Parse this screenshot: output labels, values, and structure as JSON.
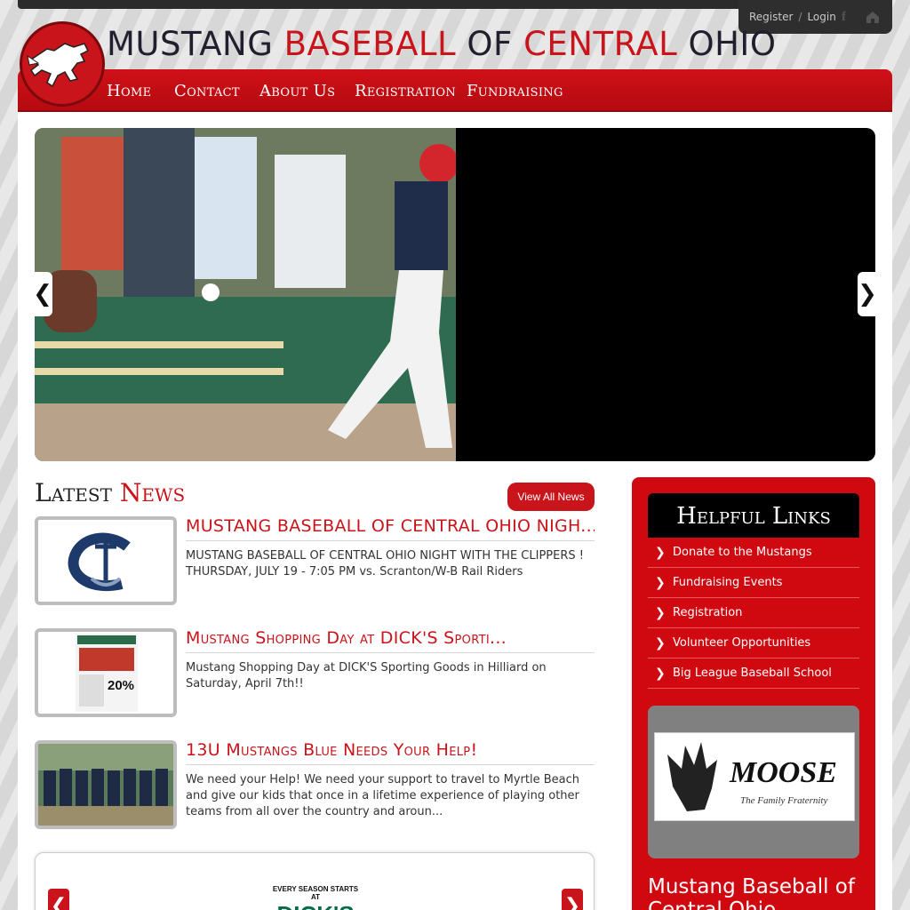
{
  "header": {
    "title_part1": "MUSTANG ",
    "title_part2": "BASEBALL",
    "title_part3": " OF ",
    "title_part4": "CENTRAL",
    "title_part5": " OHIO",
    "register_label": "Register",
    "separator": "/",
    "login_label": "Login",
    "facebook_glyph": "f"
  },
  "nav": {
    "items": [
      {
        "label": "Home"
      },
      {
        "label": "Contact"
      },
      {
        "label": "About Us"
      },
      {
        "label": "Registration"
      },
      {
        "label": "Fundraising"
      }
    ]
  },
  "slider": {
    "prev_glyph": "❮",
    "next_glyph": "❯",
    "dot_count": 3,
    "active_dot": 2
  },
  "news": {
    "heading_part1": "Latest ",
    "heading_part2": "News",
    "view_all_label": "View All News",
    "items": [
      {
        "title": "MUSTANG BASEBALL OF CENTRAL OHIO NIGH...",
        "description": "MUSTANG BASEBALL OF CENTRAL OHIO NIGHT WITH THE CLIPPERS ! THURSDAY, JULY 19 - 7:05 PM vs. Scranton/W-B Rail Riders"
      },
      {
        "title": "Mustang Shopping Day at DICK'S Sporti...",
        "description": "Mustang Shopping Day at DICK'S Sporting Goods in Hilliard on Saturday, April 7th!!",
        "thumb_badge": "20%"
      },
      {
        "title": "13U Mustangs Blue Needs Your Help!",
        "description": "We need your Help! We need your support to travel to Myrtle Beach and give our kids that once in a lifetime experience of playing other teams from all over the country and aroun..."
      }
    ]
  },
  "sponsor": {
    "dicks_top": "EVERY SEASON STARTS AT",
    "dicks_name": "DICK'S",
    "prev_glyph": "❮",
    "next_glyph": "❯"
  },
  "sidebar": {
    "heading": "Helpful Links",
    "links": [
      {
        "label": "Donate to the Mustangs"
      },
      {
        "label": "Fundraising Events"
      },
      {
        "label": "Registration"
      },
      {
        "label": "Volunteer Opportunities"
      },
      {
        "label": "Big League Baseball School"
      }
    ],
    "chevron_glyph": "❯",
    "moose_name": "MOOSE",
    "moose_tagline": "The Family Fraternity",
    "bottom_text": "Mustang Baseball of Central Ohio"
  },
  "colors": {
    "brand_red": "#c8141a",
    "nav_red": "#d01018",
    "dark": "#2e2e2e"
  }
}
